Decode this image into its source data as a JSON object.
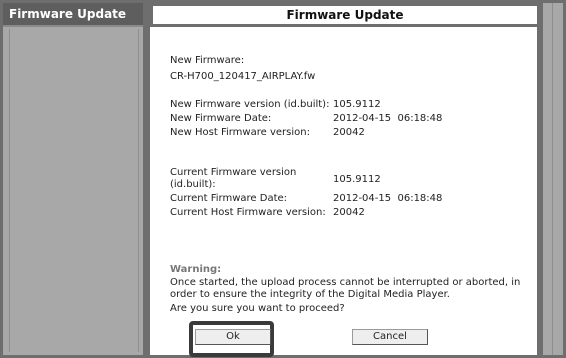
{
  "sidebar": {
    "title": "Firmware Update"
  },
  "main": {
    "title": "Firmware Update",
    "new_firmware_label": "New Firmware:",
    "new_firmware_file": "CR-H700_120417_AIRPLAY.fw",
    "new_rows": [
      {
        "label": "New Firmware version (id.built):",
        "value": "105.9112"
      },
      {
        "label": "New Firmware Date:",
        "value": "2012-04-15  06:18:48"
      },
      {
        "label": "New Host Firmware version:",
        "value": "20042"
      }
    ],
    "current_rows": [
      {
        "label": "Current Firmware version (id.built):",
        "value": "105.9112"
      },
      {
        "label": "Current Firmware Date:",
        "value": "2012-04-15  06:18:48"
      },
      {
        "label": "Current Host Firmware version:",
        "value": "20042"
      }
    ],
    "warning_title": "Warning:",
    "warning_text": "Once started, the upload process cannot be interrupted or aborted, in order to ensure the integrity of the Digital Media Player.",
    "confirm_text": "Are you sure you want to proceed?",
    "ok_label": "Ok",
    "cancel_label": "Cancel"
  }
}
